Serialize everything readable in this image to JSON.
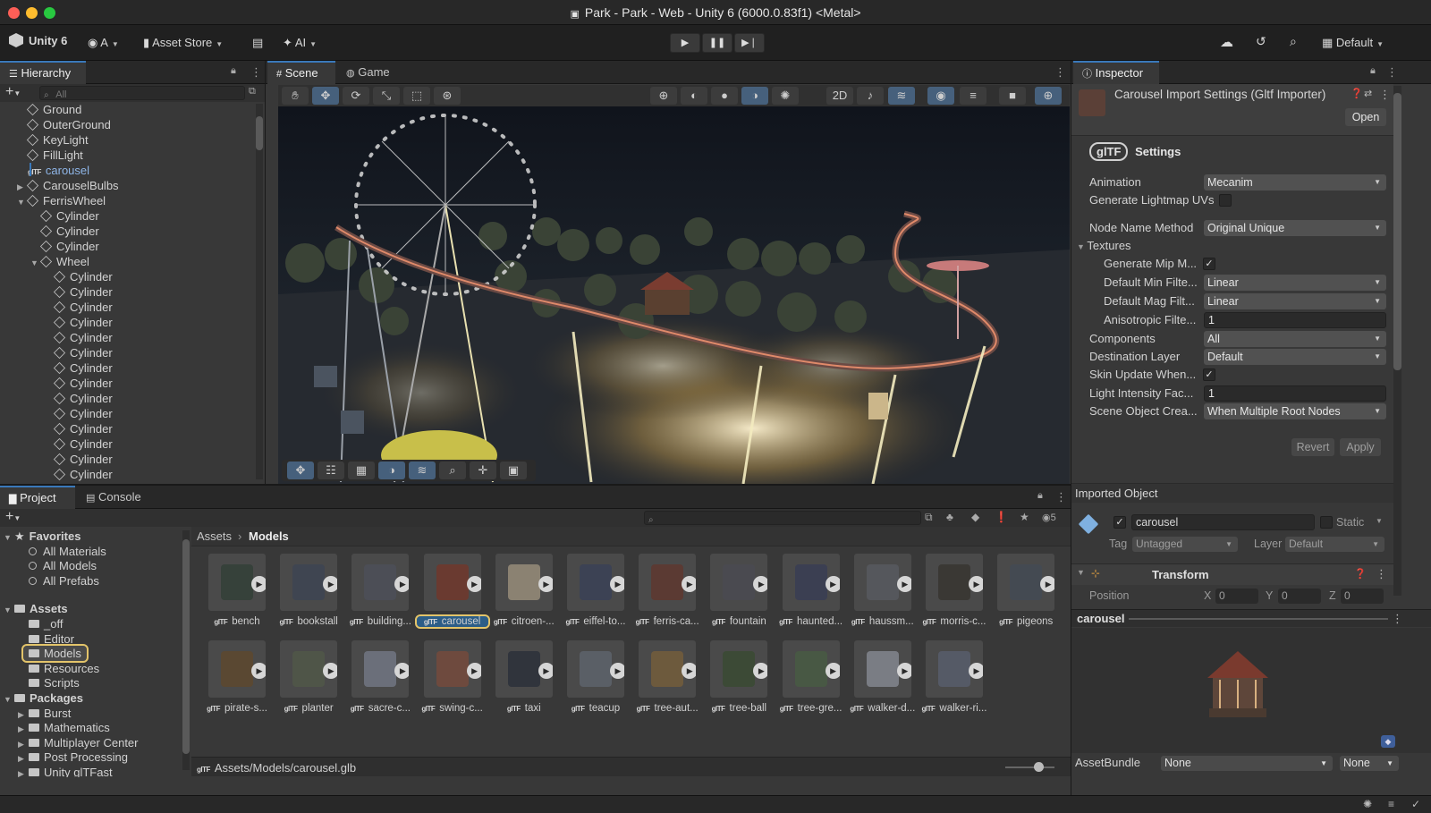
{
  "window": {
    "title": "Park - Park - Web - Unity 6 (6000.0.83f1) <Metal>"
  },
  "toolbar": {
    "unity_label": "Unity 6",
    "account_label": "A",
    "asset_store_label": "Asset Store",
    "ai_label": "AI",
    "layout_label": "Default"
  },
  "hierarchy": {
    "tab": "Hierarchy",
    "search_placeholder": "All",
    "items": [
      {
        "label": "Ground",
        "depth": 1,
        "icon": "cube",
        "expander": ""
      },
      {
        "label": "OuterGround",
        "depth": 1,
        "icon": "cube",
        "expander": ""
      },
      {
        "label": "KeyLight",
        "depth": 1,
        "icon": "cube",
        "expander": ""
      },
      {
        "label": "FillLight",
        "depth": 1,
        "icon": "cube",
        "expander": ""
      },
      {
        "label": "carousel",
        "depth": 1,
        "icon": "gltf",
        "expander": "",
        "highlight": true
      },
      {
        "label": "CarouselBulbs",
        "depth": 1,
        "icon": "cube",
        "expander": "▶"
      },
      {
        "label": "FerrisWheel",
        "depth": 1,
        "icon": "cube",
        "expander": "▼"
      },
      {
        "label": "Cylinder",
        "depth": 2,
        "icon": "cube",
        "expander": ""
      },
      {
        "label": "Cylinder",
        "depth": 2,
        "icon": "cube",
        "expander": ""
      },
      {
        "label": "Cylinder",
        "depth": 2,
        "icon": "cube",
        "expander": ""
      },
      {
        "label": "Wheel",
        "depth": 2,
        "icon": "cube",
        "expander": "▼"
      },
      {
        "label": "Cylinder",
        "depth": 3,
        "icon": "cube",
        "expander": ""
      },
      {
        "label": "Cylinder",
        "depth": 3,
        "icon": "cube",
        "expander": ""
      },
      {
        "label": "Cylinder",
        "depth": 3,
        "icon": "cube",
        "expander": ""
      },
      {
        "label": "Cylinder",
        "depth": 3,
        "icon": "cube",
        "expander": ""
      },
      {
        "label": "Cylinder",
        "depth": 3,
        "icon": "cube",
        "expander": ""
      },
      {
        "label": "Cylinder",
        "depth": 3,
        "icon": "cube",
        "expander": ""
      },
      {
        "label": "Cylinder",
        "depth": 3,
        "icon": "cube",
        "expander": ""
      },
      {
        "label": "Cylinder",
        "depth": 3,
        "icon": "cube",
        "expander": ""
      },
      {
        "label": "Cylinder",
        "depth": 3,
        "icon": "cube",
        "expander": ""
      },
      {
        "label": "Cylinder",
        "depth": 3,
        "icon": "cube",
        "expander": ""
      },
      {
        "label": "Cylinder",
        "depth": 3,
        "icon": "cube",
        "expander": ""
      },
      {
        "label": "Cylinder",
        "depth": 3,
        "icon": "cube",
        "expander": ""
      },
      {
        "label": "Cylinder",
        "depth": 3,
        "icon": "cube",
        "expander": ""
      },
      {
        "label": "Cylinder",
        "depth": 3,
        "icon": "cube",
        "expander": ""
      },
      {
        "label": "Cylinder",
        "depth": 3,
        "icon": "cube",
        "expander": ""
      }
    ]
  },
  "scene": {
    "tab_scene": "Scene",
    "tab_game": "Game"
  },
  "project": {
    "tab_project": "Project",
    "tab_console": "Console",
    "hidden_count": "5",
    "breadcrumb": [
      "Assets",
      "Models"
    ],
    "favorites_label": "Favorites",
    "favorites": [
      "All Materials",
      "All Models",
      "All Prefabs"
    ],
    "assets_label": "Assets",
    "asset_folders": [
      "_off",
      "Editor",
      "Models",
      "Resources",
      "Scripts"
    ],
    "packages_label": "Packages",
    "package_folders": [
      "Burst",
      "Mathematics",
      "Multiplayer Center",
      "Post Processing",
      "Unity glTFast"
    ],
    "status_path": "Assets/Models/carousel.glb",
    "grid": [
      {
        "label": "bench",
        "color": "#36413a"
      },
      {
        "label": "bookstall",
        "color": "#3f4551"
      },
      {
        "label": "building...",
        "color": "#4c4e56"
      },
      {
        "label": "carousel",
        "color": "#6a3a30",
        "selected": true
      },
      {
        "label": "citroen-...",
        "color": "#8b8272"
      },
      {
        "label": "eiffel-to...",
        "color": "#3c4254"
      },
      {
        "label": "ferris-ca...",
        "color": "#5b3a33"
      },
      {
        "label": "fountain",
        "color": "#4a4a50"
      },
      {
        "label": "haunted...",
        "color": "#3b3f52"
      },
      {
        "label": "haussm...",
        "color": "#55575c"
      },
      {
        "label": "morris-c...",
        "color": "#3a3834"
      },
      {
        "label": "pigeons",
        "color": "#444a52"
      },
      {
        "label": "pirate-s...",
        "color": "#5a4832"
      },
      {
        "label": "planter",
        "color": "#4f5548"
      },
      {
        "label": "sacre-c...",
        "color": "#6b6f7a"
      },
      {
        "label": "swing-c...",
        "color": "#6e4a3e"
      },
      {
        "label": "taxi",
        "color": "#30343c"
      },
      {
        "label": "teacup",
        "color": "#5a5f66"
      },
      {
        "label": "tree-aut...",
        "color": "#6d5a3d"
      },
      {
        "label": "tree-ball",
        "color": "#3c4a36"
      },
      {
        "label": "tree-gre...",
        "color": "#485844"
      },
      {
        "label": "walker-d...",
        "color": "#7a7d84"
      },
      {
        "label": "walker-ri...",
        "color": "#555a66"
      }
    ]
  },
  "inspector": {
    "tab": "Inspector",
    "title": "Carousel Import Settings (Gltf Importer)",
    "open_label": "Open",
    "logo_text": "glTF",
    "settings_label": "Settings",
    "rows": [
      {
        "label": "Animation",
        "type": "dropdown",
        "value": "Mecanim"
      },
      {
        "label": "Generate Lightmap UVs",
        "type": "checkbox",
        "value": ""
      },
      {
        "label": "Node Name Method",
        "type": "dropdown",
        "value": "Original Unique"
      },
      {
        "label": "Textures",
        "type": "section",
        "value": ""
      },
      {
        "label": "Generate Mip M...",
        "type": "checkbox",
        "value": "✓",
        "indent": true
      },
      {
        "label": "Default Min Filte...",
        "type": "dropdown",
        "value": "Linear",
        "indent": true
      },
      {
        "label": "Default Mag Filt...",
        "type": "dropdown",
        "value": "Linear",
        "indent": true
      },
      {
        "label": "Anisotropic Filte...",
        "type": "field",
        "value": "1",
        "indent": true
      },
      {
        "label": "Components",
        "type": "dropdown",
        "value": "All"
      },
      {
        "label": "Destination Layer",
        "type": "dropdown",
        "value": "Default"
      },
      {
        "label": "Skin Update When...",
        "type": "checkbox",
        "value": "✓"
      },
      {
        "label": "Light Intensity Fac...",
        "type": "field",
        "value": "1"
      },
      {
        "label": "Scene Object Crea...",
        "type": "dropdown",
        "value": "When Multiple Root Nodes"
      }
    ],
    "revert_label": "Revert",
    "apply_label": "Apply",
    "imported_object_label": "Imported Object",
    "object_name": "carousel",
    "static_label": "Static",
    "tag_label": "Tag",
    "tag_value": "Untagged",
    "layer_label": "Layer",
    "layer_value": "Default",
    "transform_label": "Transform",
    "position_label": "Position",
    "pos_x_label": "X",
    "pos_x": "0",
    "pos_y_label": "Y",
    "pos_y": "0",
    "pos_z_label": "Z",
    "pos_z": "0",
    "preview_label": "carousel",
    "assetbundle_label": "AssetBundle",
    "assetbundle_value": "None",
    "assetbundle_variant": "None"
  },
  "colors": {
    "accent": "#3a79bb",
    "selection": "#2c5d87",
    "highlight_text": "#8fb6e8"
  }
}
